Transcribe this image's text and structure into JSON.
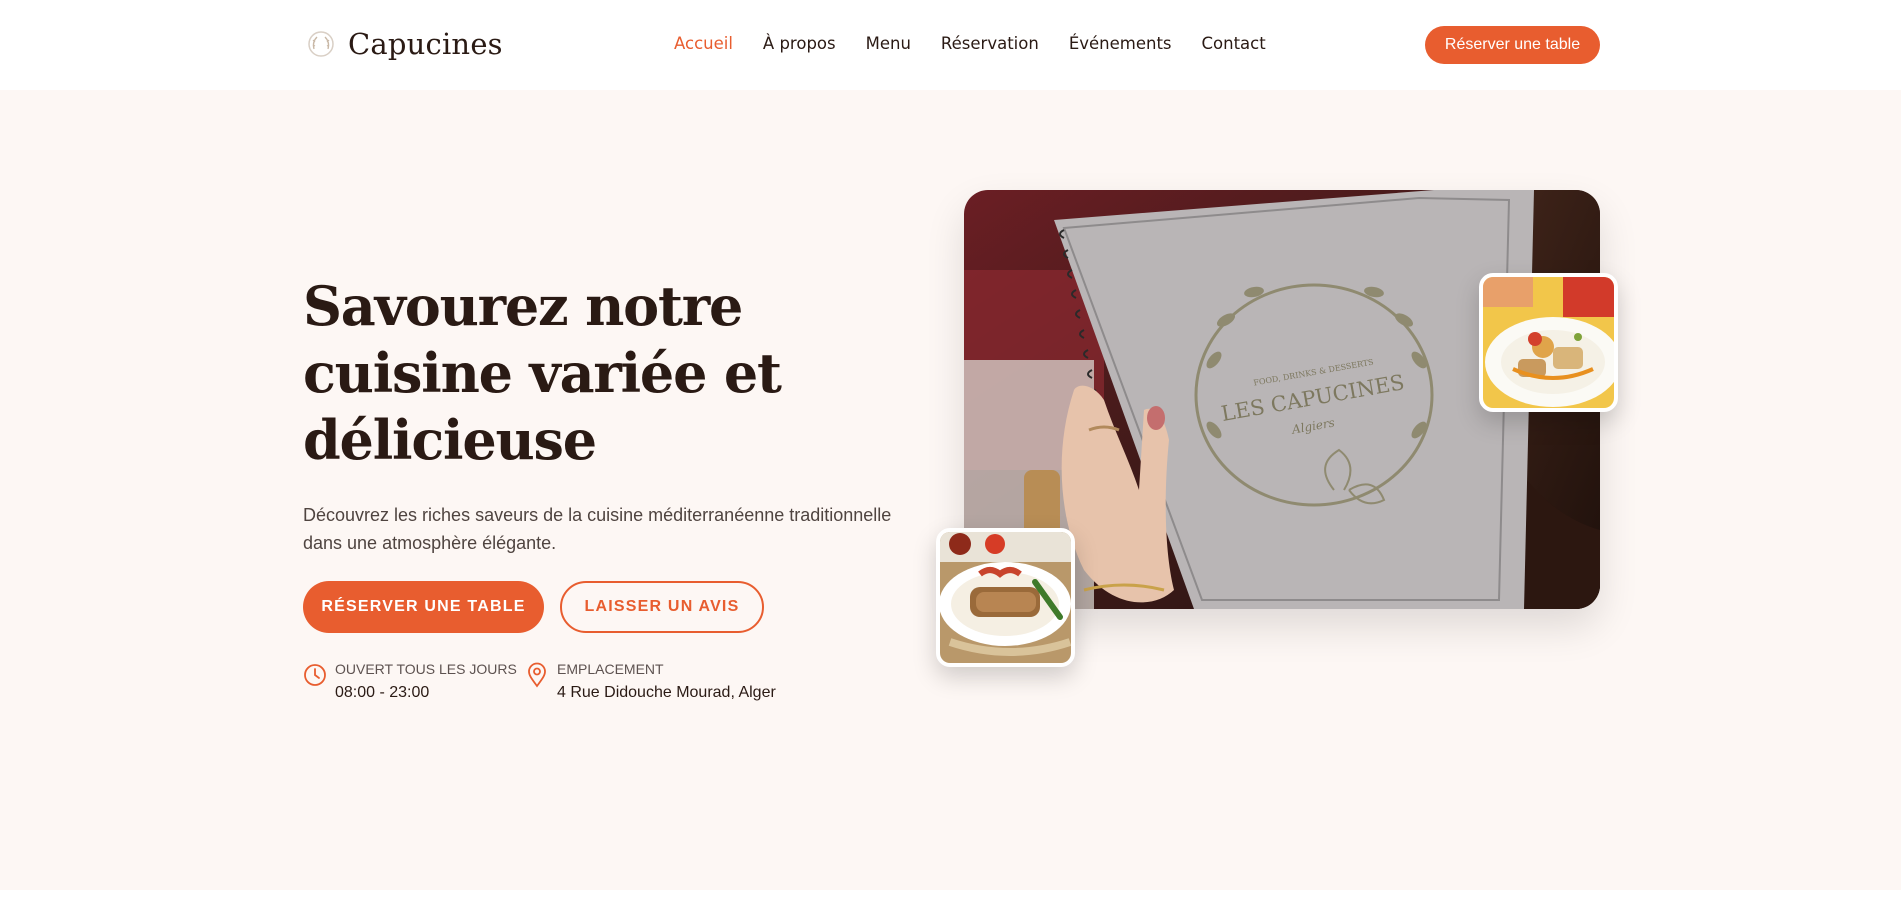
{
  "brand": {
    "name": "Capucines"
  },
  "nav": {
    "items": [
      {
        "label": "Accueil",
        "active": true
      },
      {
        "label": "À propos",
        "active": false
      },
      {
        "label": "Menu",
        "active": false
      },
      {
        "label": "Réservation",
        "active": false
      },
      {
        "label": "Événements",
        "active": false
      },
      {
        "label": "Contact",
        "active": false
      }
    ],
    "cta_label": "Réserver une table"
  },
  "hero": {
    "title": "Savourez notre cuisine variée et délicieuse",
    "subtitle": "Découvrez les riches saveurs de la cuisine méditerranéenne traditionnelle dans une atmosphère élégante.",
    "primary_button": "RÉSERVER UNE TABLE",
    "secondary_button": "LAISSER UN AVIS",
    "info": {
      "hours_label": "OUVERT TOUS LES JOURS",
      "hours_value": "08:00 - 23:00",
      "location_label": "EMPLACEMENT",
      "location_value": "4 Rue Didouche Mourad, Alger"
    },
    "menu_cover": {
      "tagline": "FOOD, DRINKS & DESSERTS",
      "name": "LES CAPUCINES",
      "city": "Algiers"
    }
  },
  "icons": {
    "logo": "leaf-wreath-icon",
    "hours": "clock-icon",
    "location": "map-pin-icon"
  },
  "colors": {
    "accent": "#e85d2f",
    "hero_background": "#fdf7f4",
    "text_dark": "#2a1a14"
  }
}
